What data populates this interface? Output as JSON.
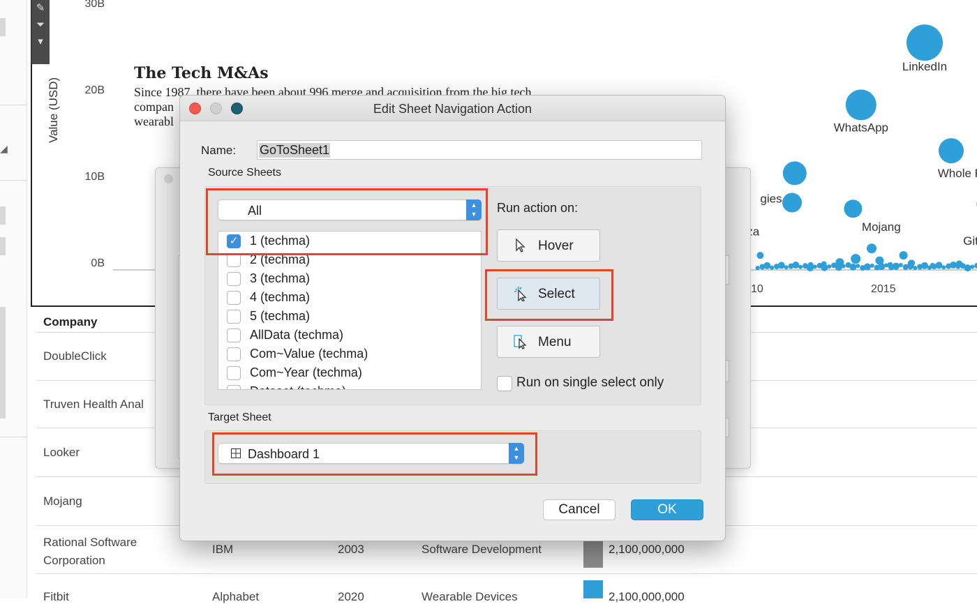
{
  "background": {
    "viz_title": "The Tech M&As",
    "viz_subtitle": "Since 1987, there have been about 996 merge and acquisition from the big tech compan… wearabl…",
    "subtitle_line1": "Since 1987, there have been about 996 merge and acquisition from the big tech",
    "subtitle_line2": "compan",
    "subtitle_line3": "wearabl",
    "table_header": "Company",
    "rows": [
      {
        "company": "DoubleClick"
      },
      {
        "company": "Truven Health Anal"
      },
      {
        "company": "Looker"
      },
      {
        "company": "Mojang"
      },
      {
        "company": "Rational Software Corporation",
        "company_line1": "Rational Software",
        "company_line2": "Corporation",
        "acquirer": "IBM",
        "year": "2003",
        "category": "Software Development",
        "value": "2,100,000,000",
        "bar_color": "#8f8f8f"
      },
      {
        "company": "Fitbit",
        "acquirer": "Alphabet",
        "year": "2020",
        "category": "Wearable Devices",
        "value": "2,100,000,000",
        "bar_color": "#2e9fd8"
      }
    ]
  },
  "chart_data": {
    "type": "scatter",
    "ylabel": "Value (USD)",
    "y_tick_labels": [
      "30B",
      "20B",
      "10B",
      "0B"
    ],
    "x_tick_labels": [
      "10",
      "2015"
    ],
    "point_color": "#2e9fd8",
    "labeled_points": [
      {
        "label": "LinkedIn",
        "year": 2016.5,
        "value": 26.2
      },
      {
        "label": "WhatsApp",
        "year": 2014.1,
        "value": 19.0
      },
      {
        "label": "Whole Foods Ma",
        "year": 2017.5,
        "value": 13.7
      },
      {
        "label": "gies",
        "year": 2011.5,
        "value": 7.7
      },
      {
        "label": "Netezza",
        "year": 2010.5,
        "value": 2.3
      },
      {
        "label": "Mojang",
        "year": 2014.6,
        "value": 2.5
      },
      {
        "label": "Git",
        "year": 2018.5,
        "value": 7.5
      }
    ],
    "points": [
      {
        "year": 2016.5,
        "value": 26.2,
        "size": 26
      },
      {
        "year": 2014.1,
        "value": 19.0,
        "size": 22
      },
      {
        "year": 2017.5,
        "value": 13.7,
        "size": 18
      },
      {
        "year": 2011.6,
        "value": 11.1,
        "size": 17
      },
      {
        "year": 2011.5,
        "value": 7.7,
        "size": 14
      },
      {
        "year": 2013.8,
        "value": 7.0,
        "size": 13
      },
      {
        "year": 2018.8,
        "value": 7.5,
        "size": 13
      },
      {
        "year": 2014.5,
        "value": 2.4,
        "size": 7
      },
      {
        "year": 2010.3,
        "value": 1.6,
        "size": 5
      },
      {
        "year": 2013.3,
        "value": 0.8,
        "size": 6
      },
      {
        "year": 2013.9,
        "value": 1.2,
        "size": 7
      },
      {
        "year": 2014.8,
        "value": 1.0,
        "size": 6
      },
      {
        "year": 2015.7,
        "value": 1.6,
        "size": 6
      },
      {
        "year": 2016.0,
        "value": 0.7,
        "size": 5
      },
      {
        "year": 2017.8,
        "value": 0.6,
        "size": 5
      },
      {
        "year": 2018.6,
        "value": 0.6,
        "size": 5
      },
      {
        "year": 2012.2,
        "value": 0.5,
        "size": 4
      },
      {
        "year": 2012.7,
        "value": 0.6,
        "size": 4
      },
      {
        "year": 2015.2,
        "value": 0.5,
        "size": 4
      },
      {
        "year": 2016.8,
        "value": 0.4,
        "size": 4
      }
    ]
  },
  "dialog": {
    "title": "Edit Sheet Navigation Action",
    "name_label": "Name:",
    "name_value": "GoToSheet1",
    "source_sheets_label": "Source Sheets",
    "source_dropdown": "All",
    "sheets": [
      {
        "label": "1 (techma)",
        "checked": true
      },
      {
        "label": "2 (techma)",
        "checked": false
      },
      {
        "label": "3 (techma)",
        "checked": false
      },
      {
        "label": "4 (techma)",
        "checked": false
      },
      {
        "label": "5 (techma)",
        "checked": false
      },
      {
        "label": "AllData (techma)",
        "checked": false
      },
      {
        "label": "Com~Value (techma)",
        "checked": false
      },
      {
        "label": "Com~Year (techma)",
        "checked": false
      },
      {
        "label": "Dataset (techma)",
        "checked": false
      }
    ],
    "run_action_on_label": "Run action on:",
    "hover_label": "Hover",
    "select_label": "Select",
    "menu_label": "Menu",
    "single_select_label": "Run on single select only",
    "target_sheet_label": "Target Sheet",
    "target_dropdown": "Dashboard 1",
    "cancel_label": "Cancel",
    "ok_label": "OK",
    "highlight_color": "#e0472a"
  }
}
